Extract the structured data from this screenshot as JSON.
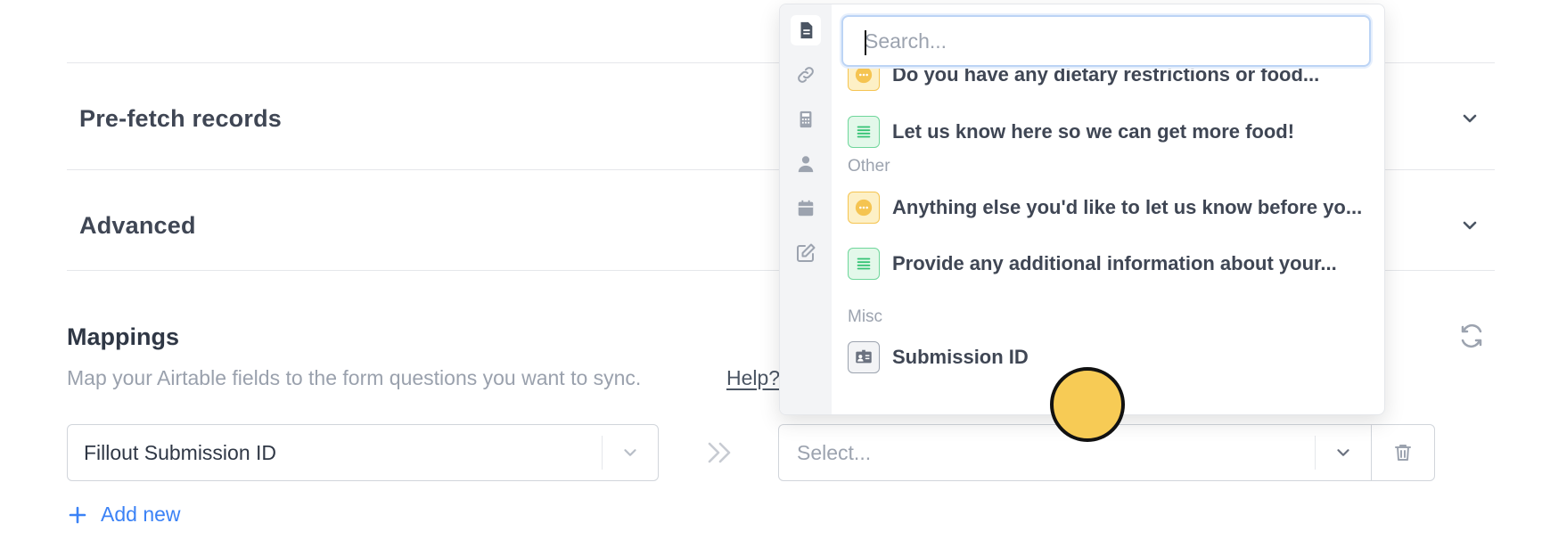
{
  "sections": [
    {
      "title": "Pre-fetch records"
    },
    {
      "title": "Advanced"
    }
  ],
  "mappings": {
    "title": "Mappings",
    "description": "Map your Airtable fields to the form questions you want to sync.",
    "help_label": "Help?",
    "left_select_value": "Fillout Submission ID",
    "right_select_placeholder": "Select...",
    "add_new_label": "Add new"
  },
  "dropdown": {
    "search_placeholder": "Search...",
    "sidebar_icons": [
      "document-icon",
      "link-icon",
      "calculator-icon",
      "person-icon",
      "calendar-icon",
      "edit-icon"
    ],
    "items": [
      {
        "label": "Do you have any dietary restrictions or food...",
        "icon": "dots-icon",
        "color": "yellow"
      },
      {
        "label": "Let us know here so we can get more food!",
        "icon": "lines-icon",
        "color": "green"
      },
      {
        "label": "Anything else you'd like to let us know before yo...",
        "icon": "dots-icon",
        "color": "yellow"
      },
      {
        "label": "Provide any additional information about your...",
        "icon": "lines-icon",
        "color": "green"
      },
      {
        "label": "Submission ID",
        "icon": "id-card-icon",
        "color": "gray"
      }
    ],
    "groups": [
      "Other",
      "Misc"
    ]
  },
  "colors": {
    "accent": "#3b82f6",
    "cursor": "#f7cb55",
    "yellow_icon": "#f5c451",
    "green_icon": "#6fd69b"
  }
}
